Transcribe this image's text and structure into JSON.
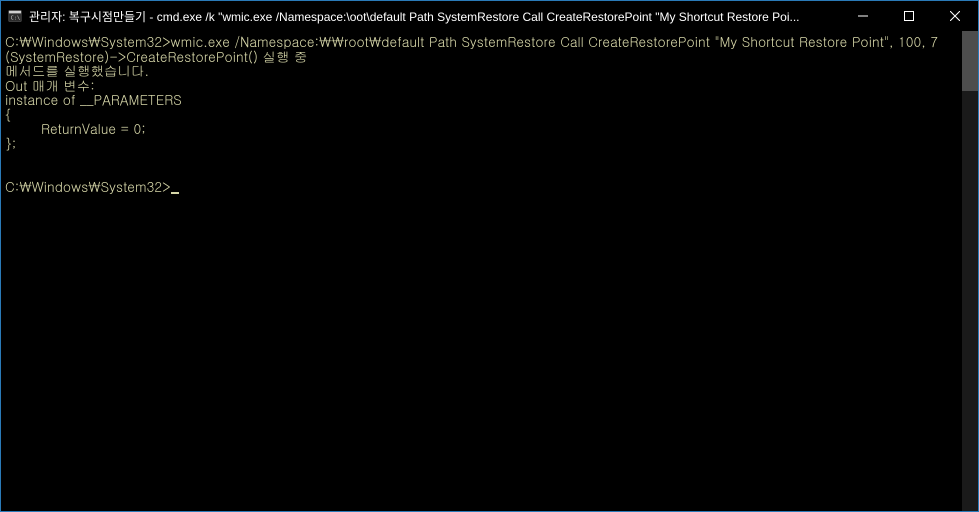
{
  "window": {
    "title": "관리자: 복구시점만들기 - cmd.exe  /k \"wmic.exe /Namespace:\\oot\\default Path SystemRestore Call CreateRestorePoint \"My Shortcut Restore Poi..."
  },
  "terminal": {
    "prompt1": "C:\\Windows\\System32>",
    "command1": "wmic.exe /Namespace:\\\\root\\default Path SystemRestore Call CreateRestorePoint \"My Shortcut Restore Point\", 100, 7",
    "output_line1": "(SystemRestore)->CreateRestorePoint() 실행 중",
    "output_line2": "메서드를 실행했습니다.",
    "output_line3": "Out 매개 변수:",
    "output_line4": "instance of __PARAMETERS",
    "output_line5": "{",
    "output_line6": "        ReturnValue = 0;",
    "output_line7": "};",
    "blank": "",
    "prompt2": "C:\\Windows\\System32>"
  }
}
